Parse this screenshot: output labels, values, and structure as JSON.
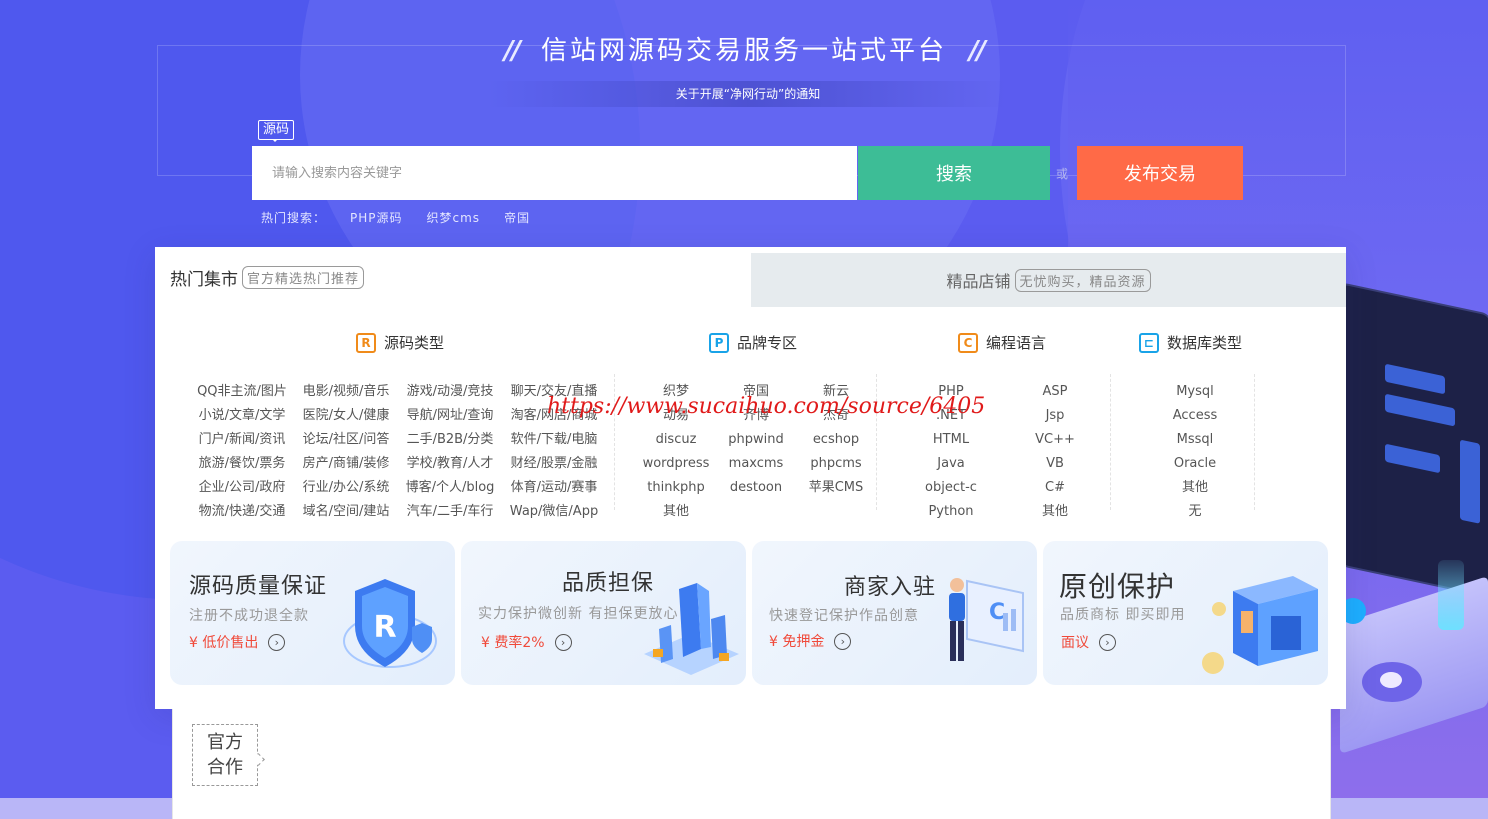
{
  "site": {
    "title": "信站网源码交易服务一站式平台",
    "title_mark": "//",
    "notice": "关于开展“净网行动”的通知"
  },
  "search": {
    "scope_label": "源码",
    "placeholder": "请输入搜索内容关键字",
    "submit_label": "搜索",
    "or_label": "或",
    "publish_label": "发布交易",
    "hot_label": "热门搜索：",
    "hot_terms": [
      "PHP源码",
      "织梦cms",
      "帝国"
    ]
  },
  "tabs": {
    "active": {
      "title": "热门集市",
      "subtitle": "官方精选热门推荐"
    },
    "inactive": {
      "title": "精品店铺",
      "subtitle": "无忧购买，精品资源"
    }
  },
  "categories": {
    "source": {
      "title": "源码类型",
      "icon": "R",
      "items": [
        "QQ非主流/图片",
        "电影/视频/音乐",
        "游戏/动漫/竞技",
        "聊天/交友/直播",
        "小说/文章/文学",
        "医院/女人/健康",
        "导航/网址/查询",
        "淘客/网店/商城",
        "门户/新闻/资讯",
        "论坛/社区/问答",
        "二手/B2B/分类",
        "软件/下载/电脑",
        "旅游/餐饮/票务",
        "房产/商铺/装修",
        "学校/教育/人才",
        "财经/股票/金融",
        "企业/公司/政府",
        "行业/办公/系统",
        "博客/个人/blog",
        "体育/运动/赛事",
        "物流/快递/交通",
        "域名/空间/建站",
        "汽车/二手/车行",
        "Wap/微信/App"
      ]
    },
    "brand": {
      "title": "品牌专区",
      "icon": "P",
      "items": [
        "织梦",
        "帝国",
        "新云",
        "动易",
        "齐博",
        "杰奇",
        "discuz",
        "phpwind",
        "ecshop",
        "wordpress",
        "maxcms",
        "phpcms",
        "thinkphp",
        "destoon",
        "苹果CMS",
        "其他",
        "",
        ""
      ]
    },
    "lang": {
      "title": "编程语言",
      "icon": "C",
      "items": [
        "PHP",
        "ASP",
        ".NET",
        "Jsp",
        "HTML",
        "VC++",
        "Java",
        "VB",
        "object-c",
        "C#",
        "Python",
        "其他"
      ]
    },
    "db": {
      "title": "数据库类型",
      "icon": "⊏",
      "items": [
        "Mysql",
        "Access",
        "Mssql",
        "Oracle",
        "其他",
        "无"
      ]
    }
  },
  "watermark": "https://www.sucaihuo.com/source/6405",
  "features": [
    {
      "title": "源码质量保证",
      "subtitle": "注册不成功退全款",
      "link": "¥ 低价售出"
    },
    {
      "title": "品质担保",
      "subtitle": "实力保护微创新 有担保更放心",
      "link": "¥ 费率2%"
    },
    {
      "title": "商家入驻",
      "subtitle": "快速登记保护作品创意",
      "link": "¥ 免押金"
    },
    {
      "title": "原创保护",
      "subtitle": "品质商标 即买即用",
      "link": "面议"
    }
  ],
  "partner": {
    "label_line1": "官方",
    "label_line2": "合作"
  },
  "colors": {
    "background": "#5b5cf0",
    "search_button": "#3dbd96",
    "publish_button": "#ff6a47",
    "icon_orange": "#f08b1a",
    "icon_blue": "#19a3e8",
    "link_red": "#f04a3a"
  }
}
